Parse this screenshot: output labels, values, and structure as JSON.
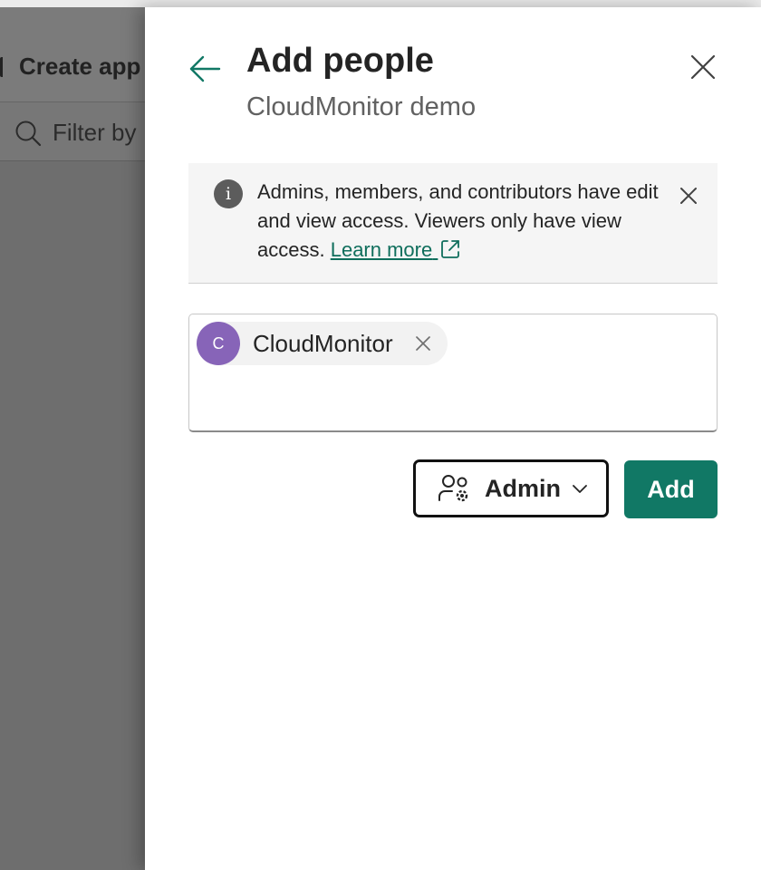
{
  "background": {
    "create_app_label": "Create app",
    "filter_placeholder": "Filter by"
  },
  "panel": {
    "title": "Add people",
    "subtitle": "CloudMonitor demo"
  },
  "banner": {
    "text": "Admins, members, and contributors have edit and view access. Viewers only have view access.",
    "link_label": "Learn more"
  },
  "picker": {
    "chips": [
      {
        "initial": "C",
        "label": "CloudMonitor"
      }
    ]
  },
  "role": {
    "selected": "Admin"
  },
  "actions": {
    "add_label": "Add"
  },
  "colors": {
    "accent": "#117865",
    "link": "#0f6e5c",
    "avatar": "#8764b8",
    "info_icon": "#5c5c5c"
  },
  "icons": {
    "back": "arrow-left-icon",
    "close": "close-icon",
    "info": "info-icon",
    "external": "open-external-icon",
    "role": "people-settings-icon",
    "chevron": "chevron-down-icon",
    "search": "search-icon"
  }
}
